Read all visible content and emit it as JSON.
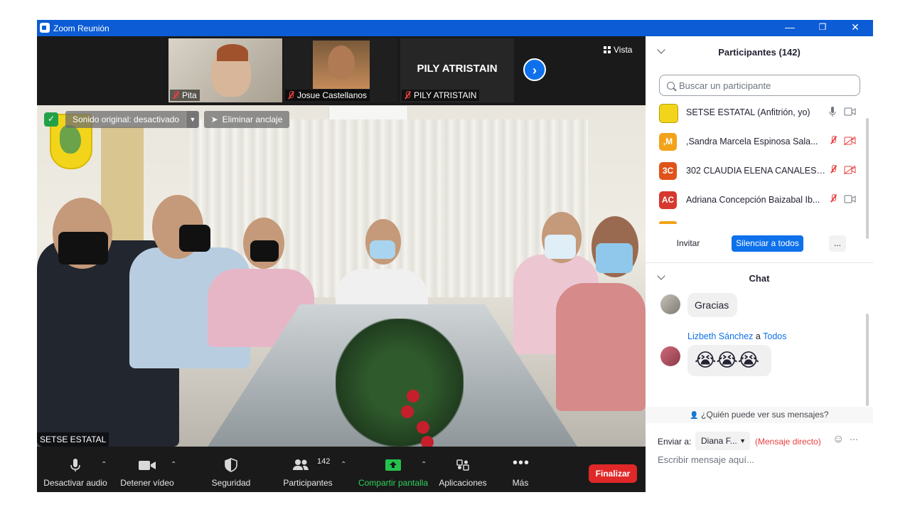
{
  "window": {
    "title": "Zoom Reunión"
  },
  "thumbnails": [
    {
      "name": "Pita"
    },
    {
      "name": "Josue Castellanos"
    },
    {
      "name": "PILY ATRISTAIN",
      "big_label": "PILY ATRISTAIN"
    }
  ],
  "view_button": "Vista",
  "overlays": {
    "sound": "Sonido original: desactivado",
    "unpin": "Eliminar anclaje"
  },
  "speaker_name": "SETSE ESTATAL",
  "toolbar": {
    "mute": "Desactivar audio",
    "video": "Detener vídeo",
    "security": "Seguridad",
    "participants": "Participantes",
    "participants_count": "142",
    "share": "Compartir pantalla",
    "apps": "Aplicaciones",
    "more": "Más",
    "end": "Finalizar"
  },
  "participants_panel": {
    "title": "Participantes (142)",
    "search_placeholder": "Buscar un participante",
    "items": [
      {
        "initials": "",
        "name": "SETSE ESTATAL (Anfitrión, yo)",
        "color": "#f2d51a"
      },
      {
        "initials": ",M",
        "name": ",Sandra Marcela Espinosa Sala...",
        "color": "#f2a31a"
      },
      {
        "initials": "3C",
        "name": "302 CLAUDIA ELENA CANALES ...",
        "color": "#e0541b"
      },
      {
        "initials": "AC",
        "name": "Adriana Concepción Baizabal Ib...",
        "color": "#d6382e"
      }
    ],
    "invite": "Invitar",
    "mute_all": "Silenciar a todos",
    "more": "..."
  },
  "chat": {
    "title": "Chat",
    "messages": [
      {
        "text": "Gracias"
      },
      {
        "sender": "Lizbeth Sánchez",
        "to_word": "a",
        "to": "Todos",
        "text": "😭😭😭"
      }
    ],
    "who_can_see": "¿Quién puede ver sus mensajes?",
    "send_to_label": "Enviar a:",
    "send_to_value": "Diana F...",
    "direct": "(Mensaje directo)",
    "input_placeholder": "Escribir mensaje aquí..."
  },
  "colors": {
    "accent": "#0e71eb",
    "titlebar": "#0b5cd5",
    "end": "#e02828",
    "share": "#24c24c",
    "muted": "#e84040"
  }
}
